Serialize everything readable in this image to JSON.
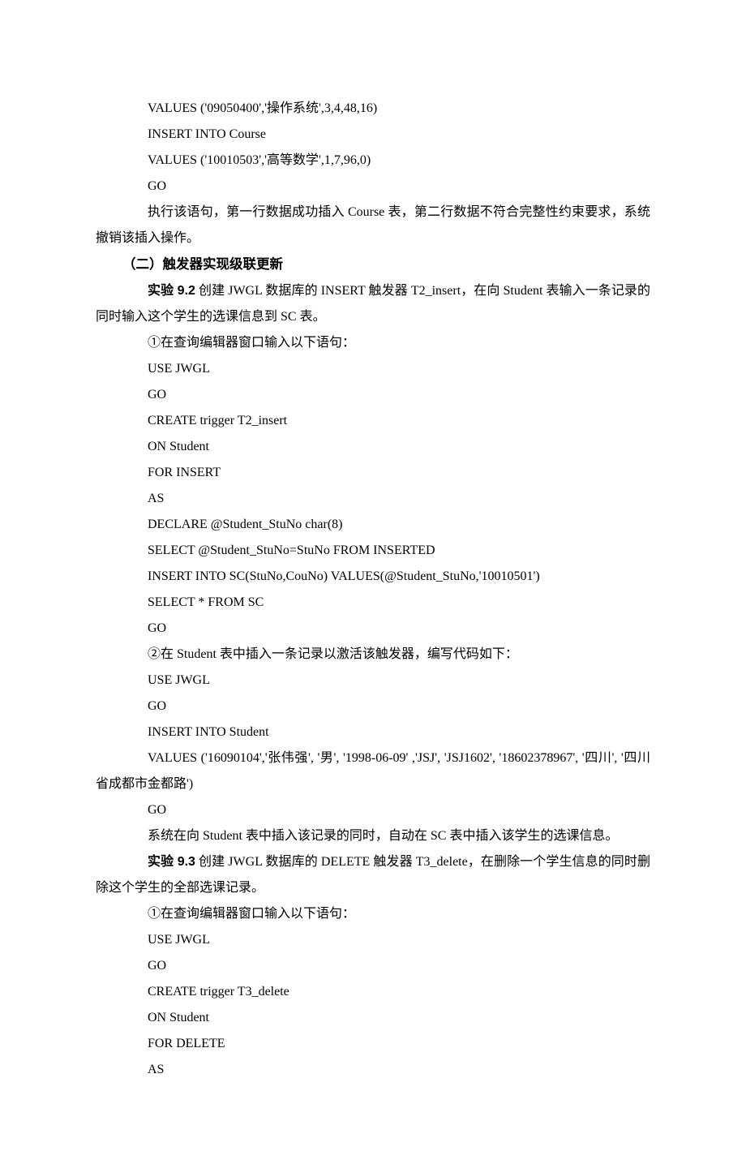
{
  "lines": {
    "l1": "VALUES ('09050400','操作系统',3,4,48,16)",
    "l2": "INSERT INTO Course",
    "l3": "VALUES ('10010503','高等数学',1,7,96,0)",
    "l4": "GO",
    "l5": "执行该语句，第一行数据成功插入 Course 表，第二行数据不符合完整性约束要求，系统撤销该插入操作。",
    "h1": "（二）触发器实现级联更新",
    "e92_lead": "实验 9.2",
    "e92_rest": " 创建 JWGL 数据库的 INSERT 触发器 T2_insert，在向 Student 表输入一条记录的同时输入这个学生的选课信息到 SC 表。",
    "l7": "①在查询编辑器窗口输入以下语句：",
    "l8": "USE JWGL",
    "l9": "GO",
    "l10": "CREATE trigger T2_insert",
    "l11": "ON Student",
    "l12": "FOR INSERT",
    "l13": "AS",
    "l14": "DECLARE @Student_StuNo char(8)",
    "l15": "SELECT @Student_StuNo=StuNo FROM INSERTED",
    "l16": "INSERT INTO SC(StuNo,CouNo) VALUES(@Student_StuNo,'10010501')",
    "l17": "SELECT * FROM SC",
    "l18": "GO",
    "l19": "②在 Student 表中插入一条记录以激活该触发器，编写代码如下：",
    "l20": "USE JWGL",
    "l21": "GO",
    "l22": "INSERT INTO Student",
    "l23": "VALUES ('16090104','张伟强', '男', '1998-06-09' ,'JSJ', 'JSJ1602', '18602378967', '四川', '四川省成都市金都路')",
    "l24": "GO",
    "l25": "系统在向 Student 表中插入该记录的同时，自动在 SC 表中插入该学生的选课信息。",
    "e93_lead": "实验 9.3",
    "e93_rest": " 创建 JWGL 数据库的 DELETE 触发器 T3_delete，在删除一个学生信息的同时删除这个学生的全部选课记录。",
    "l27": "①在查询编辑器窗口输入以下语句：",
    "l28": "USE JWGL",
    "l29": "GO",
    "l30": "CREATE trigger T3_delete",
    "l31": "ON Student",
    "l32": "FOR DELETE",
    "l33": "AS"
  }
}
